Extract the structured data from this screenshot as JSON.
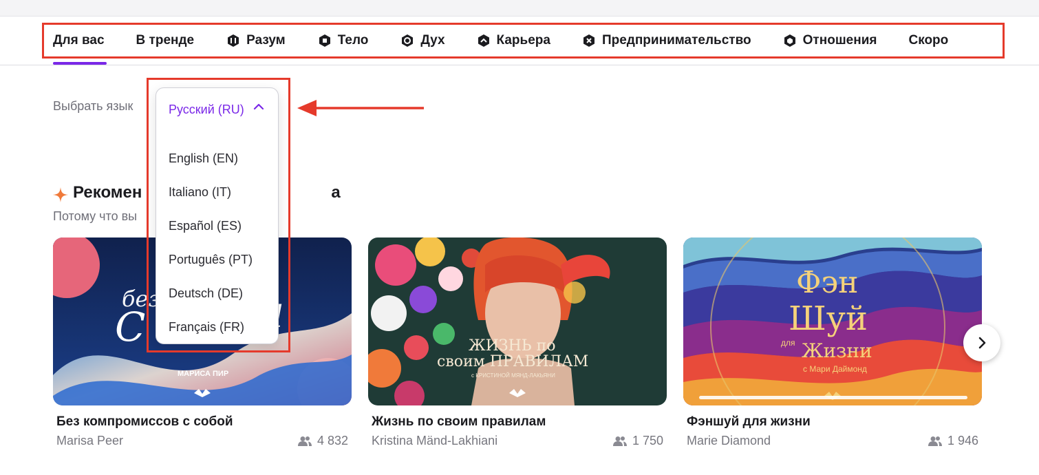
{
  "nav": {
    "items": [
      {
        "label": "Для вас",
        "icon": "none",
        "active": true
      },
      {
        "label": "В тренде",
        "icon": "none",
        "active": false
      },
      {
        "label": "Разум",
        "icon": "mind-hex-icon",
        "active": false
      },
      {
        "label": "Тело",
        "icon": "body-hex-icon",
        "active": false
      },
      {
        "label": "Дух",
        "icon": "spirit-ring-icon",
        "active": false
      },
      {
        "label": "Карьера",
        "icon": "career-chevron-icon",
        "active": false
      },
      {
        "label": "Предпринимательство",
        "icon": "entrepreneurship-hex-icon",
        "active": false
      },
      {
        "label": "Отношения",
        "icon": "relationships-hex-icon",
        "active": false
      },
      {
        "label": "Скоро",
        "icon": "none",
        "active": false
      }
    ]
  },
  "language": {
    "label": "Выбрать язык",
    "selected": "Русский (RU)",
    "options": [
      "English (EN)",
      "Italiano (IT)",
      "Español (ES)",
      "Português (PT)",
      "Deutsch (DE)",
      "Français (FR)"
    ]
  },
  "recommendations": {
    "title_left": "Рекомен",
    "title_right": "а",
    "subtitle": "Потому что вы"
  },
  "courses": [
    {
      "title": "Без компромиссов с собой",
      "author": "Marisa Peer",
      "count": "4 832",
      "cover_text": "МАРИСА ПИР"
    },
    {
      "title": "Жизнь по своим правилам",
      "author": "Kristina Mänd-Lakhiani",
      "count": "1 750",
      "cover_line1": "ЖИЗНЬ по",
      "cover_line2": "своим ПРАВИЛАМ",
      "cover_line3": "с КРИСТИНОЙ МЯНД-ЛАКЬЯНИ"
    },
    {
      "title": "Фэншуй для жизни",
      "author": "Marie Diamond",
      "count": "1 946",
      "cover_line1": "Фэн",
      "cover_line2": "Шуй",
      "cover_line3": "для",
      "cover_line4": "Жизни",
      "cover_line5": "с Мари Даймонд"
    }
  ],
  "colors": {
    "accent": "#7a28e8",
    "highlight": "#e53a2b"
  }
}
